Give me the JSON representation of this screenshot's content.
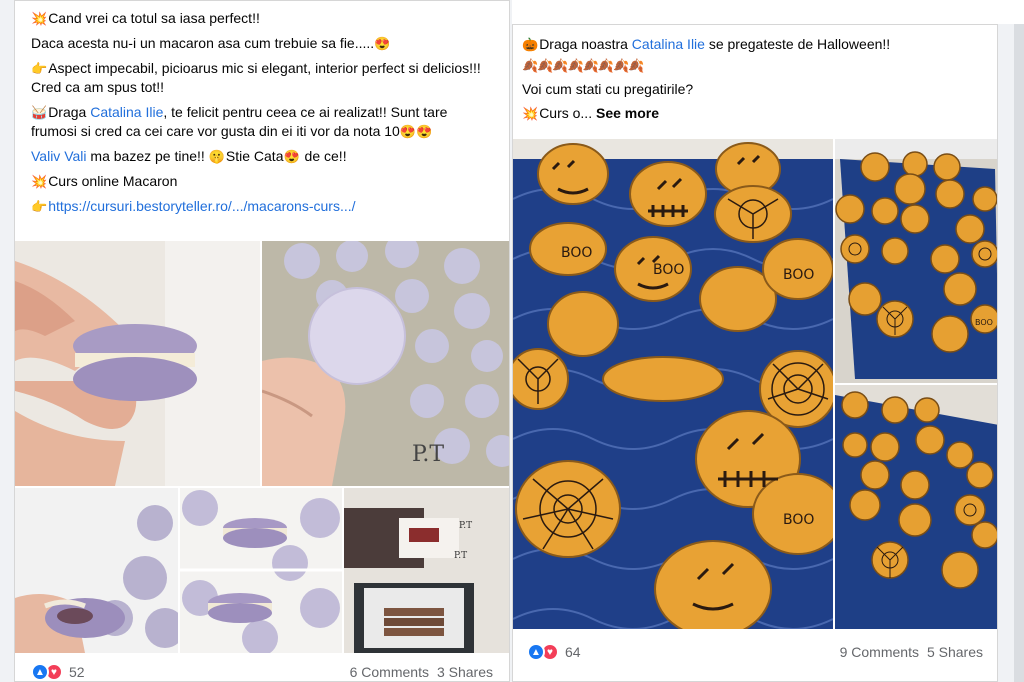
{
  "left_post": {
    "lines": {
      "line1_emoji": "💥",
      "line1": "Cand vrei ca totul sa iasa perfect!!",
      "line2": "Daca acesta nu-i un macaron asa cum trebuie sa fie.....",
      "line2_emoji": "😍",
      "line3_emoji": "👉",
      "line3": "Aspect impecabil, picioarus mic si elegant, interior perfect si delicios!!! Cred ca am spus tot!!",
      "line4_emoji": "🥁",
      "line4_pre": "Draga ",
      "line4_mention": "Catalina Ilie",
      "line4_post": ", te felicit pentru ceea ce ai realizat!! Sunt tare frumosi si cred ca cei care vor gusta din ei iti vor da nota 10",
      "line4_emojis": "😍😍",
      "line5_mention": "Valiv Vali",
      "line5_text": " ma bazez pe tine!! ",
      "line5_emoji1": "🤫",
      "line5_text2": "Stie Cata",
      "line5_emoji2": "😍",
      "line5_text3": " de ce!!",
      "line6_emoji": "💥",
      "line6": "Curs online Macaron",
      "line7_emoji": "👉",
      "line7_link": "https://cursuri.bestoryteller.ro/.../macarons-curs.../"
    },
    "footer": {
      "reactions": "52",
      "comments": "6 Comments",
      "shares": "3 Shares"
    },
    "photo_text": {
      "mat_label": "P.T",
      "mat_label2": "P.T",
      "box_label": "P.T"
    }
  },
  "right_post": {
    "lines": {
      "line1_emoji": "🎃",
      "line1_pre": "Draga noastra ",
      "line1_mention": "Catalina Ilie",
      "line1_post": " se pregateste de Halloween!!",
      "emoji_row": "🍂🍂🍂🍂🍂🍂🍂🍂",
      "line2": "Voi cum stati cu pregatirile?",
      "line3_emoji": "💥",
      "line3": "Curs o...",
      "see_more": "See more"
    },
    "footer": {
      "reactions": "64",
      "comments": "9 Comments",
      "shares": "5 Shares"
    },
    "photo_text": {
      "boo1": "BOO",
      "boo2": "BOO",
      "boo3": "BOO",
      "boo4": "BOO",
      "boo5": "BOO"
    }
  },
  "colors": {
    "link_blue": "#216fdb",
    "like_blue": "#1877f2",
    "love_red": "#f33e58",
    "macaron_lavender": "#b3a7cc",
    "macaron_orange": "#e9a43a",
    "tray_blue": "#1d3f8a"
  },
  "icons": {
    "like": "thumbs-up-icon",
    "love": "heart-icon"
  }
}
